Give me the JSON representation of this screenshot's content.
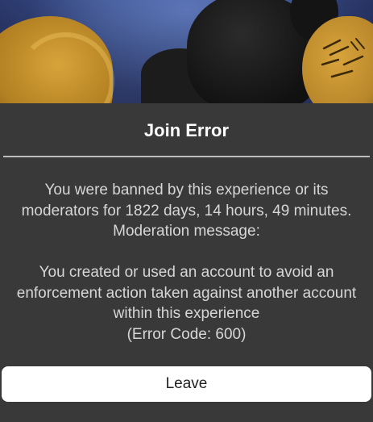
{
  "dialog": {
    "title": "Join Error",
    "message_lines": [
      "You were banned by this experience or its",
      "moderators for 1822 days, 14 hours, 49 minutes.",
      "Moderation message:",
      "",
      "You created or used an account to avoid an",
      "enforcement action taken against another account",
      "within this experience",
      "(Error Code: 600)"
    ],
    "leave_label": "Leave"
  },
  "colors": {
    "dialog_background": "#393939",
    "title_text": "#ffffff",
    "message_text": "#d6d6d6",
    "button_background": "#ffffff",
    "button_text": "#1f1f1f"
  }
}
